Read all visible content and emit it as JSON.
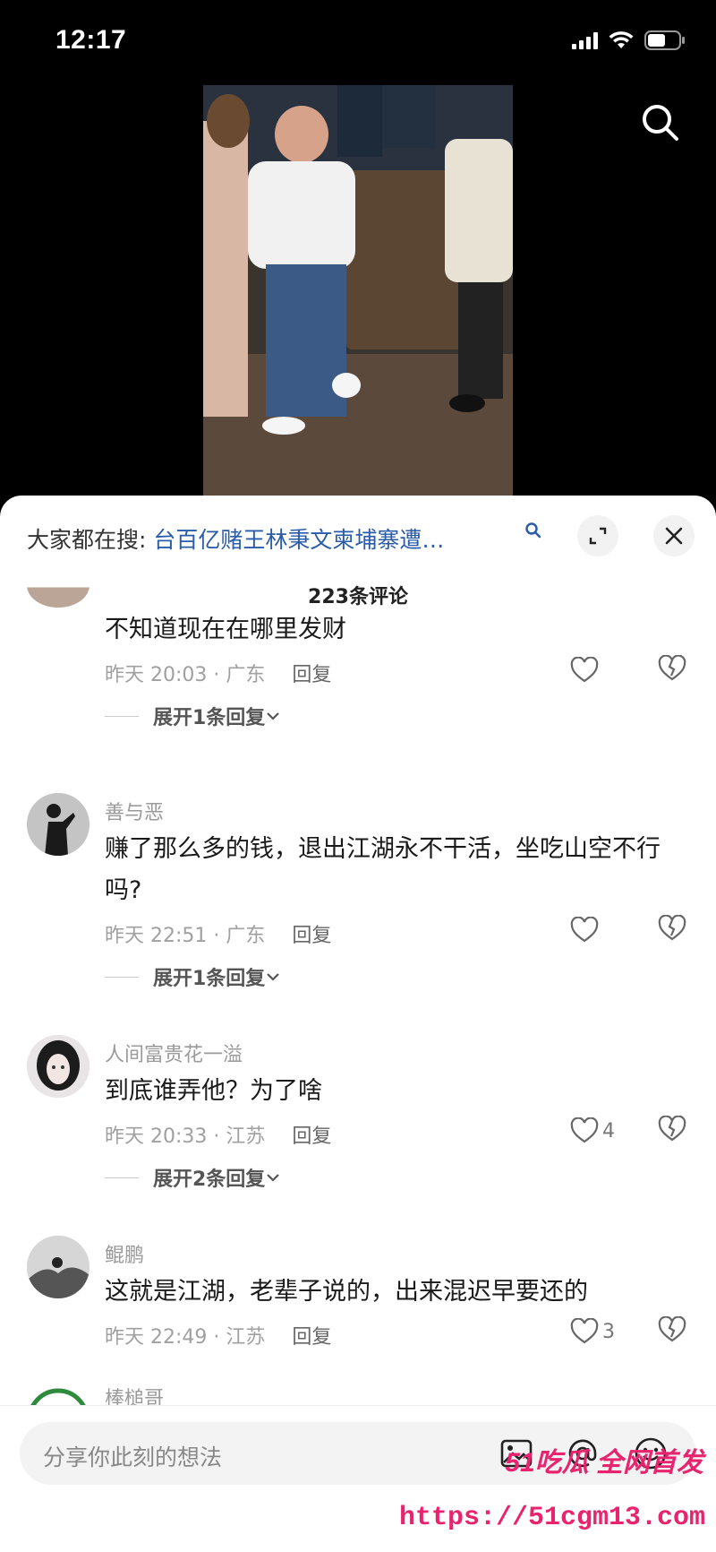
{
  "status_bar": {
    "time": "12:17"
  },
  "video": {
    "description_icon": "search-icon"
  },
  "sheet": {
    "hot_search_prefix": "大家都在搜:",
    "hot_search_query": "台百亿赌王林秉文柬埔寨遭…",
    "comment_count": "223条评论"
  },
  "comments": [
    {
      "user": "",
      "text": "不知道现在在哪里发财",
      "time_location": "昨天 20:03 · 广东",
      "reply_label": "回复",
      "likes": "",
      "expand": "展开1条回复"
    },
    {
      "user": "善与恶",
      "text": "赚了那么多的钱，退出江湖永不干活，坐吃山空不行吗?",
      "time_location": "昨天 22:51 · 广东",
      "reply_label": "回复",
      "likes": "",
      "expand": "展开1条回复"
    },
    {
      "user": "人间富贵花一溢",
      "text": "到底谁弄他？为了啥",
      "time_location": "昨天 20:33 · 江苏",
      "reply_label": "回复",
      "likes": "4",
      "expand": "展开2条回复"
    },
    {
      "user": "鲲鹏",
      "text": "这就是江湖，老辈子说的，出来混迟早要还的",
      "time_location": "昨天 22:49 · 江苏",
      "reply_label": "回复",
      "likes": "3",
      "expand": ""
    },
    {
      "user": "棒槌哥",
      "text": "",
      "time_location": "",
      "reply_label": "",
      "likes": "",
      "expand": ""
    }
  ],
  "input_bar": {
    "placeholder": "分享你此刻的想法"
  },
  "watermark": {
    "brand": "51吃瓜 全网首发",
    "url": "https://51cgm13.com"
  }
}
